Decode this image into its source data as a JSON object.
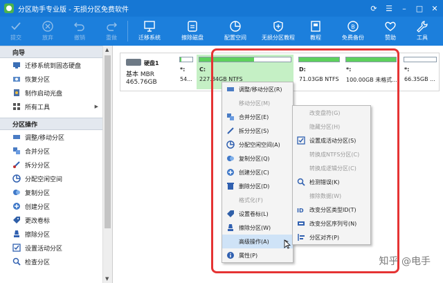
{
  "window": {
    "title": "分区助手专业版 - 无损分区免费软件",
    "controls": [
      "⟳",
      "☰",
      "–",
      "□",
      "✕"
    ]
  },
  "toolbar": [
    {
      "label": "提交",
      "icon": "check-icon",
      "disabled": true
    },
    {
      "label": "放弃",
      "icon": "discard-icon",
      "disabled": true
    },
    {
      "label": "撤销",
      "icon": "undo-icon",
      "disabled": true
    },
    {
      "label": "重做",
      "icon": "redo-icon",
      "disabled": true
    },
    {
      "label": "迁移系统",
      "icon": "migrate-icon",
      "disabled": false
    },
    {
      "label": "擦除磁盘",
      "icon": "wipe-disk-icon",
      "disabled": false
    },
    {
      "label": "配置空间",
      "icon": "allocate-space-icon",
      "disabled": false
    },
    {
      "label": "无损分区教程",
      "icon": "shield-icon",
      "disabled": false
    },
    {
      "label": "教程",
      "icon": "tutorial-icon",
      "disabled": false
    },
    {
      "label": "免费备份",
      "icon": "backup-icon",
      "disabled": false
    },
    {
      "label": "赞助",
      "icon": "heart-icon",
      "disabled": false
    },
    {
      "label": "工具",
      "icon": "wrench-icon",
      "disabled": false
    }
  ],
  "sidebar": {
    "wizard_header": "向导",
    "wizard_items": [
      {
        "label": "迁移系统到固态硬盘",
        "icon": "migrate-ssd-icon"
      },
      {
        "label": "恢复分区",
        "icon": "recover-icon"
      },
      {
        "label": "制作启动光盘",
        "icon": "boot-disc-icon"
      },
      {
        "label": "所有工具",
        "icon": "tools-icon",
        "has_submenu": true
      }
    ],
    "ops_header": "分区操作",
    "ops_items": [
      {
        "label": "调整/移动分区",
        "icon": "resize-icon"
      },
      {
        "label": "合并分区",
        "icon": "merge-icon"
      },
      {
        "label": "拆分分区",
        "icon": "split-icon"
      },
      {
        "label": "分配空闲空间",
        "icon": "allocate-icon"
      },
      {
        "label": "复制分区",
        "icon": "copy-icon"
      },
      {
        "label": "创建分区",
        "icon": "create-icon"
      },
      {
        "label": "更改卷标",
        "icon": "label-icon"
      },
      {
        "label": "擦除分区",
        "icon": "wipe-icon"
      },
      {
        "label": "设置活动分区",
        "icon": "active-icon"
      },
      {
        "label": "检查分区",
        "icon": "check-partition-icon"
      }
    ]
  },
  "disk": {
    "name": "硬盘1",
    "type": "基本 MBR",
    "size": "465.76GB",
    "partitions": [
      {
        "label": "*:",
        "info": "54...",
        "fill": 0.1,
        "selected": false
      },
      {
        "label": "C:",
        "info": "227.84GB NTFS",
        "fill": 0.6,
        "selected": true
      },
      {
        "label": "D:",
        "info": "71.03GB NTFS",
        "fill": 1.0,
        "selected": false
      },
      {
        "label": "*:",
        "info": "100.00GB 未格式...",
        "fill": 1.0,
        "selected": false
      },
      {
        "label": "*:",
        "info": "66.35GB ...",
        "fill": 0.0,
        "selected": false
      }
    ]
  },
  "context_menu": [
    {
      "label": "调整/移动分区(R)",
      "icon": "resize-icon",
      "disabled": false
    },
    {
      "label": "移动分区(M)",
      "icon": "",
      "disabled": true
    },
    {
      "label": "合并分区(E)",
      "icon": "merge-icon",
      "disabled": false
    },
    {
      "label": "拆分分区(S)",
      "icon": "split-icon",
      "disabled": false
    },
    {
      "label": "分配空闲空间(A)",
      "icon": "allocate-icon",
      "disabled": false
    },
    {
      "label": "复制分区(Q)",
      "icon": "copy-icon",
      "disabled": false
    },
    {
      "label": "创建分区(C)",
      "icon": "create-icon",
      "disabled": false
    },
    {
      "label": "删除分区(D)",
      "icon": "delete-icon",
      "disabled": false
    },
    {
      "label": "格式化(F)",
      "icon": "",
      "disabled": true
    },
    {
      "label": "设置卷标(L)",
      "icon": "label-icon",
      "disabled": false
    },
    {
      "label": "擦除分区(W)",
      "icon": "wipe-icon",
      "disabled": false
    },
    {
      "label": "高级操作(A)",
      "icon": "",
      "disabled": false,
      "highlighted": true,
      "has_submenu": true
    },
    {
      "label": "属性(P)",
      "icon": "info-icon",
      "disabled": false
    }
  ],
  "submenu": [
    {
      "label": "改变盘符(G)",
      "icon": "",
      "disabled": true
    },
    {
      "label": "隐藏分区(H)",
      "icon": "",
      "disabled": true
    },
    {
      "label": "设置成活动分区(S)",
      "icon": "active-icon",
      "disabled": false
    },
    {
      "label": "转换成NTFS分区(C)",
      "icon": "",
      "disabled": true
    },
    {
      "label": "转换成逻辑分区(C)",
      "icon": "",
      "disabled": true
    },
    {
      "label": "检测错误(K)",
      "icon": "search-icon",
      "disabled": false
    },
    {
      "label": "擦除数据(W)",
      "icon": "",
      "disabled": true
    },
    {
      "label": "改变分区类型ID(T)",
      "icon": "id-icon",
      "disabled": false
    },
    {
      "label": "改变分区序列号(N)",
      "icon": "serial-icon",
      "disabled": false
    },
    {
      "label": "分区对齐(P)",
      "icon": "align-icon",
      "disabled": false
    }
  ],
  "watermark": "知乎 @电手",
  "colors": {
    "accent": "#1c7fdc",
    "highlight": "#e53333",
    "partition_fill": "#5dd05d"
  }
}
